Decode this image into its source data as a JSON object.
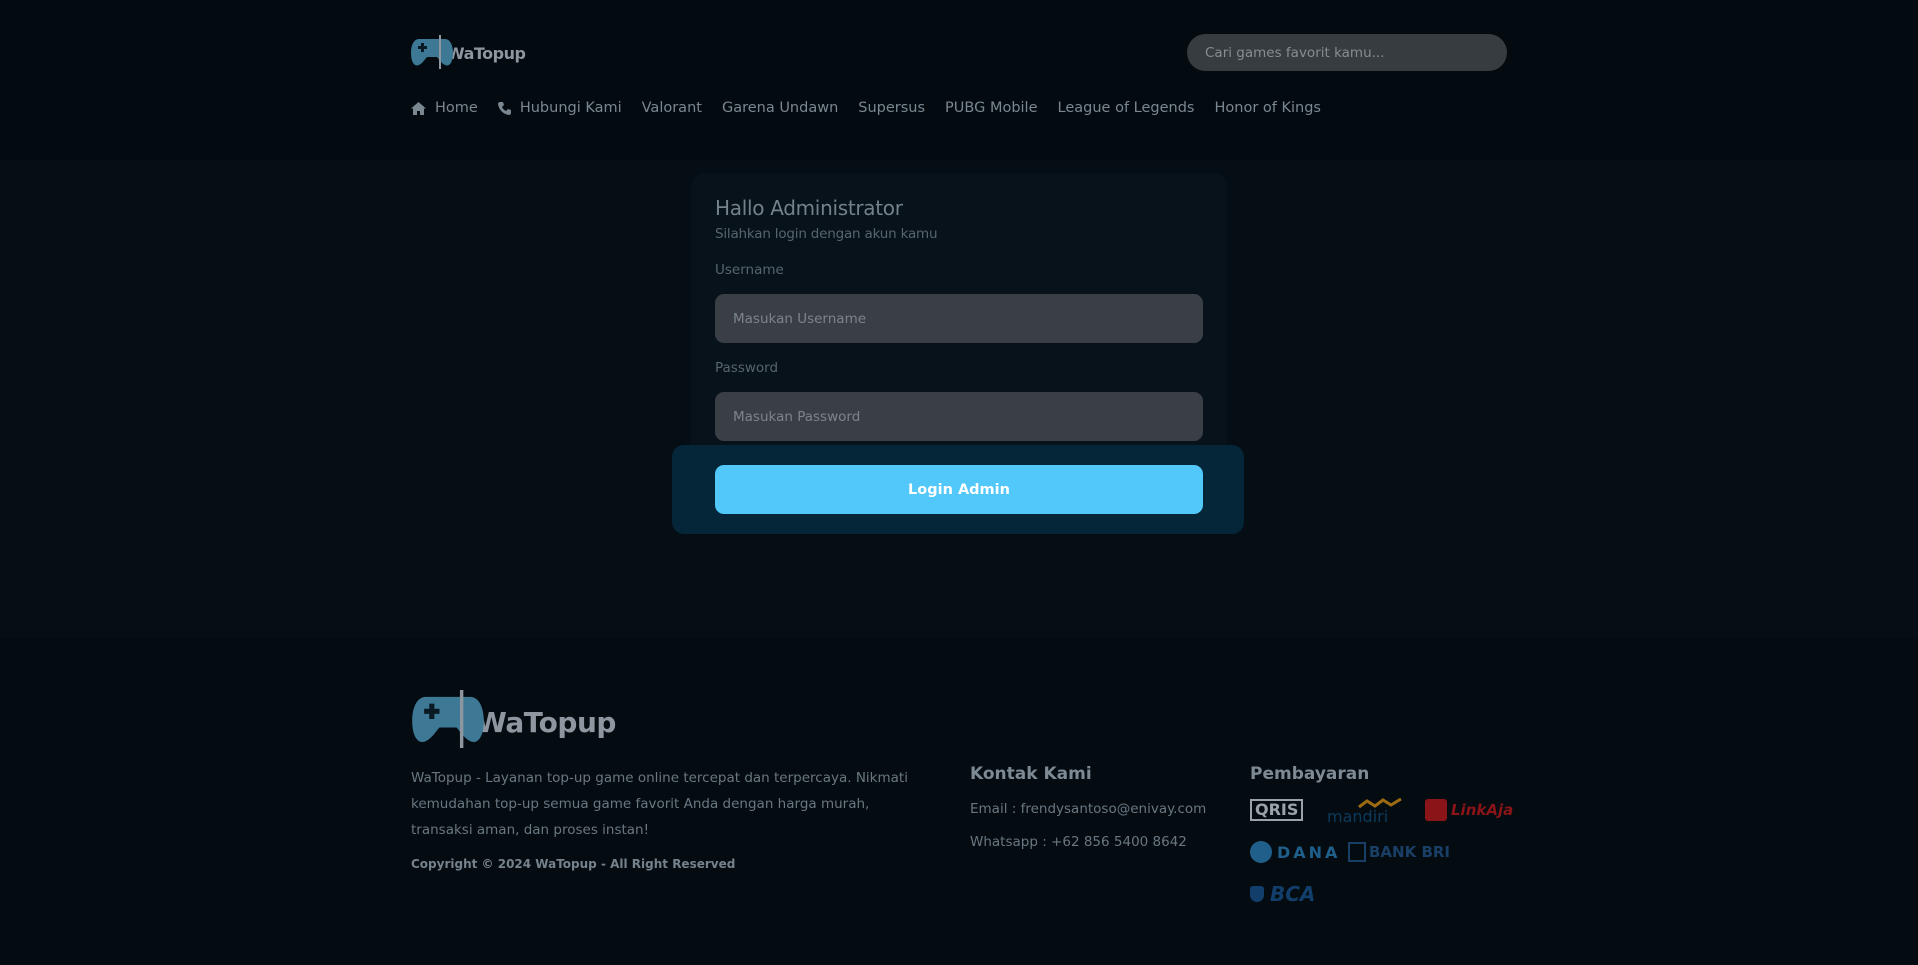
{
  "brand": {
    "name": "WaTopup"
  },
  "header": {
    "search_placeholder": "Cari games favorit kamu..."
  },
  "nav": {
    "items": [
      {
        "label": "Home",
        "icon": "home-icon"
      },
      {
        "label": "Hubungi Kami",
        "icon": "phone-icon"
      },
      {
        "label": "Valorant"
      },
      {
        "label": "Garena Undawn"
      },
      {
        "label": "Supersus"
      },
      {
        "label": "PUBG Mobile"
      },
      {
        "label": "League of Legends"
      },
      {
        "label": "Honor of Kings"
      }
    ]
  },
  "login": {
    "title": "Hallo Administrator",
    "subtitle": "Silahkan login dengan akun kamu",
    "username_label": "Username",
    "username_placeholder": "Masukan Username",
    "password_label": "Password",
    "password_placeholder": "Masukan Password",
    "button_label": "Login Admin"
  },
  "footer": {
    "description": "WaTopup - Layanan top-up game online tercepat dan terpercaya. Nikmati kemudahan top-up semua game favorit Anda dengan harga murah, transaksi aman, dan proses instan!",
    "copyright": "Copyright © 2024 WaTopup - All Right Reserved",
    "contact_title": "Kontak Kami",
    "email": "Email : frendysantoso@enivay.com",
    "whatsapp": "Whatsapp : +62 856 5400 8642",
    "payment_title": "Pembayaran",
    "payments": [
      {
        "name": "QRIS",
        "color": "#9aa3aa"
      },
      {
        "name": "mandiri",
        "color": "#0b3a5c"
      },
      {
        "name": "LinkAja",
        "color": "#8a1417"
      },
      {
        "name": "DANA",
        "color": "#1f5f8a"
      },
      {
        "name": "BANK BRI",
        "color": "#1a3f66"
      },
      {
        "name": "BCA",
        "color": "#123e6b"
      }
    ]
  },
  "colors": {
    "accent": "#51c7fa",
    "background": "#050e15",
    "logo_blue": "#3d7895"
  }
}
